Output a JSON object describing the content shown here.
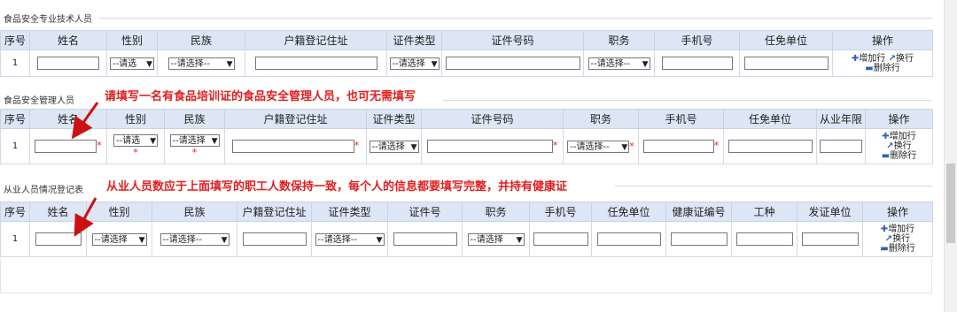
{
  "s1": {
    "title": "食品安全专业技术人员",
    "headers": [
      "序号",
      "姓名",
      "性别",
      "民族",
      "户籍登记住址",
      "证件类型",
      "证件号码",
      "职务",
      "手机号",
      "任免单位",
      "操作"
    ],
    "row": {
      "no": "1",
      "gender": "--请选",
      "ethnic": "--请选择--",
      "idtype": "--请选择",
      "position": "--请选择--"
    },
    "ops": {
      "add": "增加行",
      "newline": "换行",
      "del": "删除行"
    }
  },
  "s2": {
    "title": "食品安全管理人员",
    "note": "请填写一名有食品培训证的食品安全管理人员，也可无需填写",
    "headers": [
      "序号",
      "姓名",
      "性别",
      "民族",
      "户籍登记住址",
      "证件类型",
      "证件号码",
      "职务",
      "手机号",
      "任免单位",
      "从业年限",
      "操作"
    ],
    "row": {
      "no": "1",
      "gender": "--请选",
      "ethnic": "--请选择",
      "idtype": "--请选择",
      "position": "--请选择--"
    },
    "req": "*",
    "ops": {
      "add": "增加行",
      "newline": "换行",
      "del": "删除行"
    }
  },
  "s3": {
    "title": "从业人员情况登记表",
    "note": "从业人员数应于上面填写的职工人数保持一致，每个人的信息都要填写完整，并持有健康证",
    "headers": [
      "序号",
      "姓名",
      "性别",
      "民族",
      "户籍登记住址",
      "证件类型",
      "证件号",
      "职务",
      "手机号",
      "任免单位",
      "健康证编号",
      "工种",
      "发证单位",
      "操作"
    ],
    "row": {
      "no": "1",
      "gender": "--请选择",
      "ethnic": "--请选择--",
      "idtype": "--请选择--",
      "position": "--请选择"
    },
    "ops": {
      "add": "增加行",
      "newline": "换行",
      "del": "删除行"
    }
  },
  "colors": {
    "header_bg": "#dde6f5",
    "note_red": "#e02020",
    "icon_blue": "#2f63b0"
  }
}
